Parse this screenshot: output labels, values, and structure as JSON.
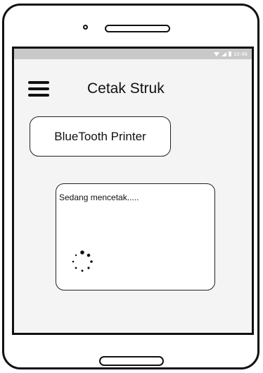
{
  "status_bar": {
    "time": "10:46"
  },
  "header": {
    "title": "Cetak Struk",
    "menu_icon": "hamburger-menu-icon"
  },
  "main": {
    "printer_button_label": "BlueTooth Printer"
  },
  "dialog": {
    "message": "Sedang mencetak.....",
    "spinner_icon": "loading-spinner-icon"
  }
}
